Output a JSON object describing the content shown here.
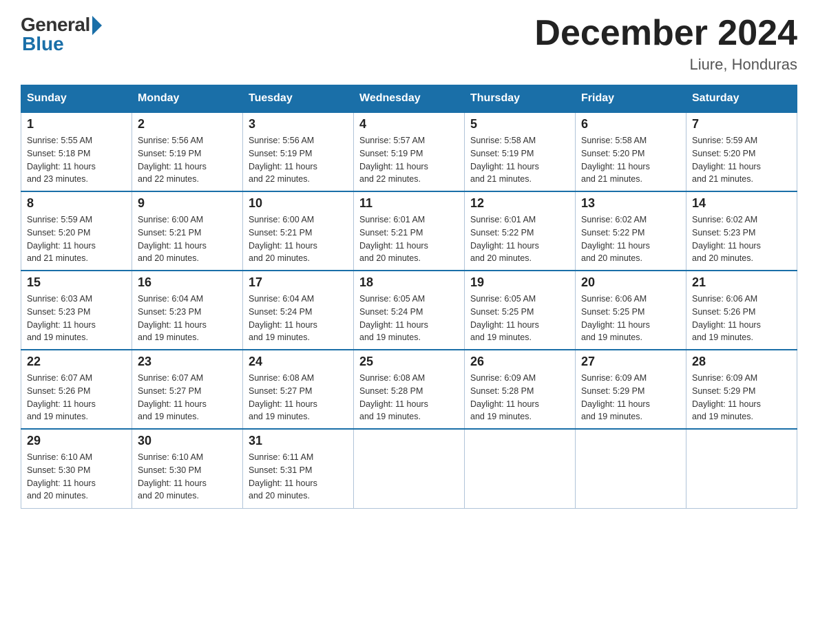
{
  "header": {
    "logo_general": "General",
    "logo_blue": "Blue",
    "title": "December 2024",
    "location": "Liure, Honduras"
  },
  "days_of_week": [
    "Sunday",
    "Monday",
    "Tuesday",
    "Wednesday",
    "Thursday",
    "Friday",
    "Saturday"
  ],
  "weeks": [
    [
      {
        "day": "1",
        "sunrise": "5:55 AM",
        "sunset": "5:18 PM",
        "daylight": "11 hours and 23 minutes."
      },
      {
        "day": "2",
        "sunrise": "5:56 AM",
        "sunset": "5:19 PM",
        "daylight": "11 hours and 22 minutes."
      },
      {
        "day": "3",
        "sunrise": "5:56 AM",
        "sunset": "5:19 PM",
        "daylight": "11 hours and 22 minutes."
      },
      {
        "day": "4",
        "sunrise": "5:57 AM",
        "sunset": "5:19 PM",
        "daylight": "11 hours and 22 minutes."
      },
      {
        "day": "5",
        "sunrise": "5:58 AM",
        "sunset": "5:19 PM",
        "daylight": "11 hours and 21 minutes."
      },
      {
        "day": "6",
        "sunrise": "5:58 AM",
        "sunset": "5:20 PM",
        "daylight": "11 hours and 21 minutes."
      },
      {
        "day": "7",
        "sunrise": "5:59 AM",
        "sunset": "5:20 PM",
        "daylight": "11 hours and 21 minutes."
      }
    ],
    [
      {
        "day": "8",
        "sunrise": "5:59 AM",
        "sunset": "5:20 PM",
        "daylight": "11 hours and 21 minutes."
      },
      {
        "day": "9",
        "sunrise": "6:00 AM",
        "sunset": "5:21 PM",
        "daylight": "11 hours and 20 minutes."
      },
      {
        "day": "10",
        "sunrise": "6:00 AM",
        "sunset": "5:21 PM",
        "daylight": "11 hours and 20 minutes."
      },
      {
        "day": "11",
        "sunrise": "6:01 AM",
        "sunset": "5:21 PM",
        "daylight": "11 hours and 20 minutes."
      },
      {
        "day": "12",
        "sunrise": "6:01 AM",
        "sunset": "5:22 PM",
        "daylight": "11 hours and 20 minutes."
      },
      {
        "day": "13",
        "sunrise": "6:02 AM",
        "sunset": "5:22 PM",
        "daylight": "11 hours and 20 minutes."
      },
      {
        "day": "14",
        "sunrise": "6:02 AM",
        "sunset": "5:23 PM",
        "daylight": "11 hours and 20 minutes."
      }
    ],
    [
      {
        "day": "15",
        "sunrise": "6:03 AM",
        "sunset": "5:23 PM",
        "daylight": "11 hours and 19 minutes."
      },
      {
        "day": "16",
        "sunrise": "6:04 AM",
        "sunset": "5:23 PM",
        "daylight": "11 hours and 19 minutes."
      },
      {
        "day": "17",
        "sunrise": "6:04 AM",
        "sunset": "5:24 PM",
        "daylight": "11 hours and 19 minutes."
      },
      {
        "day": "18",
        "sunrise": "6:05 AM",
        "sunset": "5:24 PM",
        "daylight": "11 hours and 19 minutes."
      },
      {
        "day": "19",
        "sunrise": "6:05 AM",
        "sunset": "5:25 PM",
        "daylight": "11 hours and 19 minutes."
      },
      {
        "day": "20",
        "sunrise": "6:06 AM",
        "sunset": "5:25 PM",
        "daylight": "11 hours and 19 minutes."
      },
      {
        "day": "21",
        "sunrise": "6:06 AM",
        "sunset": "5:26 PM",
        "daylight": "11 hours and 19 minutes."
      }
    ],
    [
      {
        "day": "22",
        "sunrise": "6:07 AM",
        "sunset": "5:26 PM",
        "daylight": "11 hours and 19 minutes."
      },
      {
        "day": "23",
        "sunrise": "6:07 AM",
        "sunset": "5:27 PM",
        "daylight": "11 hours and 19 minutes."
      },
      {
        "day": "24",
        "sunrise": "6:08 AM",
        "sunset": "5:27 PM",
        "daylight": "11 hours and 19 minutes."
      },
      {
        "day": "25",
        "sunrise": "6:08 AM",
        "sunset": "5:28 PM",
        "daylight": "11 hours and 19 minutes."
      },
      {
        "day": "26",
        "sunrise": "6:09 AM",
        "sunset": "5:28 PM",
        "daylight": "11 hours and 19 minutes."
      },
      {
        "day": "27",
        "sunrise": "6:09 AM",
        "sunset": "5:29 PM",
        "daylight": "11 hours and 19 minutes."
      },
      {
        "day": "28",
        "sunrise": "6:09 AM",
        "sunset": "5:29 PM",
        "daylight": "11 hours and 19 minutes."
      }
    ],
    [
      {
        "day": "29",
        "sunrise": "6:10 AM",
        "sunset": "5:30 PM",
        "daylight": "11 hours and 20 minutes."
      },
      {
        "day": "30",
        "sunrise": "6:10 AM",
        "sunset": "5:30 PM",
        "daylight": "11 hours and 20 minutes."
      },
      {
        "day": "31",
        "sunrise": "6:11 AM",
        "sunset": "5:31 PM",
        "daylight": "11 hours and 20 minutes."
      },
      null,
      null,
      null,
      null
    ]
  ],
  "labels": {
    "sunrise": "Sunrise:",
    "sunset": "Sunset:",
    "daylight": "Daylight:"
  }
}
